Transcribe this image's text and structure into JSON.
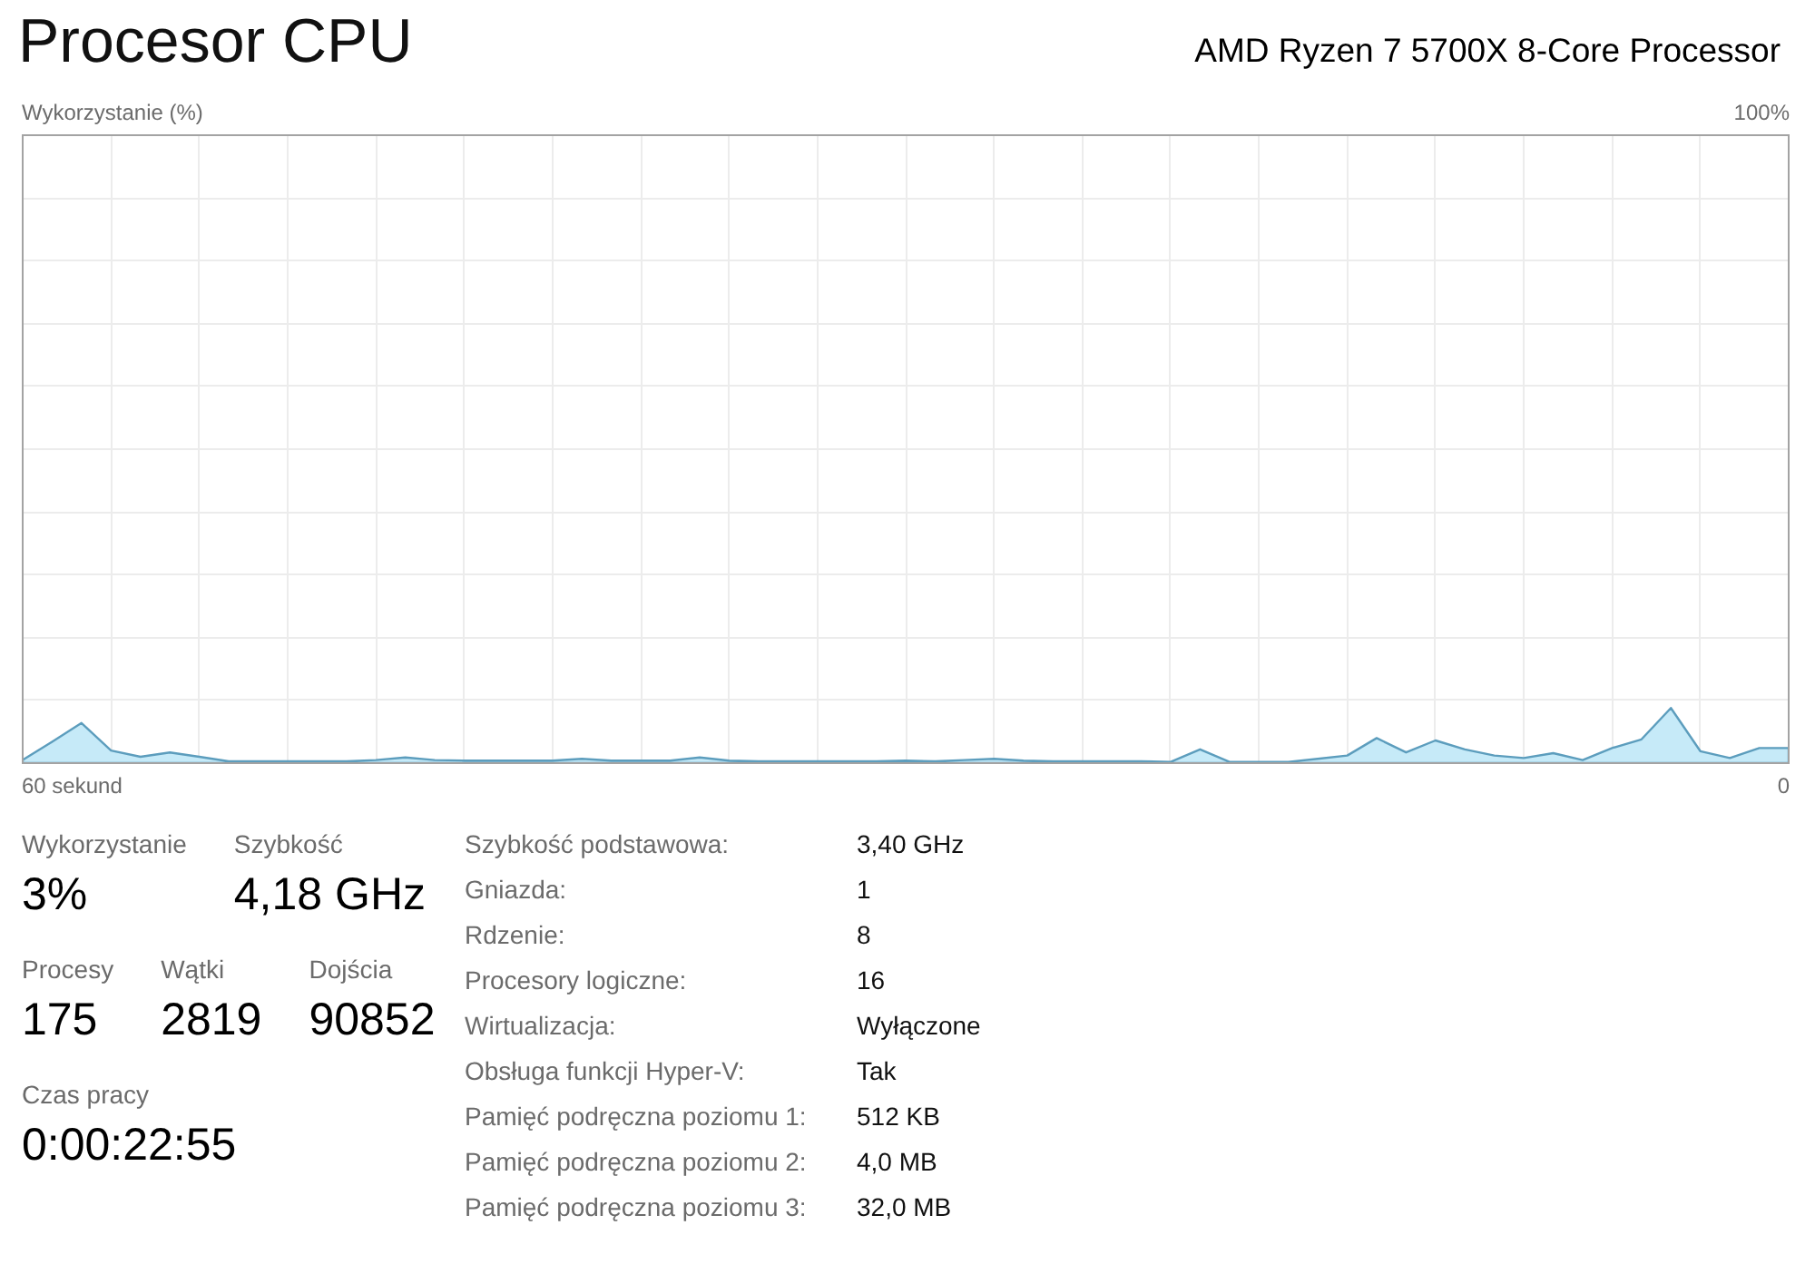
{
  "header": {
    "title": "Procesor CPU",
    "processor_name": "AMD Ryzen 7 5700X 8-Core Processor"
  },
  "usage_graph": {
    "label": "Wykorzystanie (%)",
    "max_label": "100%",
    "start_label": "60 sekund",
    "end_label": "0"
  },
  "stats": [
    [
      {
        "label": "Wykorzystanie",
        "value": "3%"
      },
      {
        "label": "Szybkość",
        "value": "4,18 GHz"
      }
    ],
    [
      {
        "label": "Procesy",
        "value": "175"
      },
      {
        "label": "Wątki",
        "value": "2819"
      },
      {
        "label": "Dojścia",
        "value": "90852"
      }
    ],
    [
      {
        "label": "Czas pracy",
        "value": "0:00:22:55"
      }
    ]
  ],
  "details": [
    {
      "label": "Szybkość podstawowa:",
      "value": "3,40 GHz"
    },
    {
      "label": "Gniazda:",
      "value": "1"
    },
    {
      "label": "Rdzenie:",
      "value": "8"
    },
    {
      "label": "Procesory logiczne:",
      "value": "16"
    },
    {
      "label": "Wirtualizacja:",
      "value": "Wyłączone"
    },
    {
      "label": "Obsługa funkcji Hyper-V:",
      "value": "Tak"
    },
    {
      "label": "Pamięć podręczna poziomu 1:",
      "value": "512 KB"
    },
    {
      "label": "Pamięć podręczna poziomu 2:",
      "value": "4,0 MB"
    },
    {
      "label": "Pamięć podręczna poziomu 3:",
      "value": "32,0 MB"
    }
  ]
}
